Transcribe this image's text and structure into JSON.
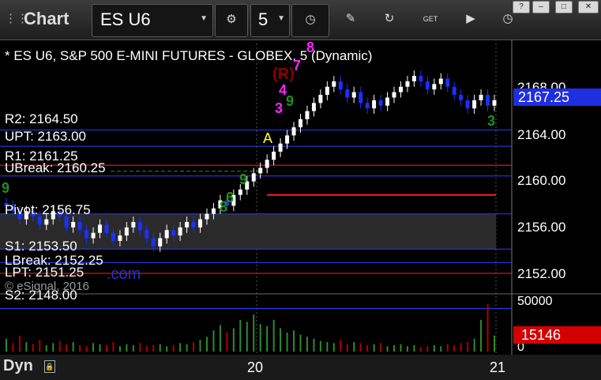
{
  "toolbar": {
    "title": "Chart",
    "symbol": "ES U6",
    "interval": "5"
  },
  "chart": {
    "header": "* ES U6, S&P 500 E-MINI FUTURES - GLOBEX, 5 (Dynamic)",
    "last_price": "2167.25",
    "volume_last": "15146",
    "volume_ticks": [
      "50000",
      "0"
    ],
    "price_ticks": [
      "2168.00",
      "2164.00",
      "2160.00",
      "2156.00",
      "2152.00"
    ],
    "date_ticks": [
      "20",
      "21"
    ],
    "status_label": "Dyn",
    "watermark": "© eSignal, 2016",
    "watermark_com": ".com",
    "signal_a": "A"
  },
  "levels": [
    {
      "label": "R2: 2164.50"
    },
    {
      "label": "UPT: 2163.00"
    },
    {
      "label": "R1: 2161.25"
    },
    {
      "label": "UBreak: 2160.25"
    },
    {
      "label": "Pivot: 2156.75"
    },
    {
      "label": "S1: 2153.50"
    },
    {
      "label": "LBreak: 2152.25"
    },
    {
      "label": "LPT: 2151.25"
    },
    {
      "label": "S2: 2148.00"
    }
  ],
  "sequence_labels": {
    "magenta": [
      "3",
      "4",
      "7",
      "8"
    ],
    "dark_red": "(R)",
    "green": [
      "9",
      "8",
      "6",
      "9",
      "9",
      "3"
    ]
  },
  "colors": {
    "up_candle": "#ffffff",
    "down_candle": "#1a30ff",
    "level_blue": "#2a3cff",
    "level_red": "#ff2020",
    "range_fill": "#2a2a2a",
    "volume_bar": "#b00000",
    "volume_bar_up": "#2e8b2e",
    "last_price_bg": "#1e2ee0",
    "volume_last_bg": "#d40000",
    "magenta": "#ff22ff",
    "green_count": "#1f8f1f"
  },
  "chart_data": {
    "type": "candlestick",
    "title": "* ES U6, S&P 500 E-MINI FUTURES - GLOBEX, 5 (Dynamic)",
    "y_unit": "price",
    "ylim": [
      2149.5,
      2172.5
    ],
    "horizontal_levels": [
      {
        "name": "R2",
        "value": 2164.5
      },
      {
        "name": "UPT",
        "value": 2163.0
      },
      {
        "name": "R1",
        "value": 2161.25
      },
      {
        "name": "UBreak",
        "value": 2160.25
      },
      {
        "name": "Pivot",
        "value": 2156.75
      },
      {
        "name": "S1",
        "value": 2153.5
      },
      {
        "name": "LBreak",
        "value": 2152.25
      },
      {
        "name": "LPT",
        "value": 2151.25
      },
      {
        "name": "S2",
        "value": 2148.0
      }
    ],
    "close_series": [
      2157.5,
      2157.0,
      2156.25,
      2157.0,
      2156.5,
      2155.75,
      2156.25,
      2157.0,
      2156.5,
      2155.5,
      2156.0,
      2155.25,
      2154.5,
      2155.0,
      2155.75,
      2155.0,
      2154.25,
      2154.75,
      2155.5,
      2156.0,
      2155.25,
      2154.5,
      2153.75,
      2154.5,
      2155.25,
      2154.75,
      2155.5,
      2156.0,
      2155.5,
      2156.25,
      2156.75,
      2157.25,
      2158.0,
      2157.5,
      2158.5,
      2159.0,
      2159.75,
      2160.5,
      2161.0,
      2161.75,
      2162.5,
      2163.25,
      2164.0,
      2164.75,
      2165.5,
      2166.25,
      2167.0,
      2167.75,
      2168.5,
      2169.0,
      2168.25,
      2167.5,
      2168.0,
      2167.0,
      2166.5,
      2167.25,
      2166.75,
      2167.5,
      2168.0,
      2168.5,
      2169.0,
      2169.5,
      2169.0,
      2168.25,
      2168.75,
      2169.25,
      2168.5,
      2167.75,
      2167.25,
      2166.5,
      2167.25,
      2167.75,
      2166.75,
      2167.25
    ],
    "volume_series": [
      12000,
      8000,
      15000,
      9000,
      7000,
      11000,
      6000,
      8000,
      10000,
      7000,
      9000,
      6000,
      5000,
      8000,
      7000,
      6000,
      9000,
      5000,
      7000,
      6000,
      8000,
      5000,
      6000,
      7000,
      5000,
      6000,
      8000,
      7000,
      9000,
      11000,
      14000,
      20000,
      25000,
      18000,
      22000,
      30000,
      28000,
      35000,
      26000,
      24000,
      30000,
      22000,
      18000,
      20000,
      16000,
      14000,
      12000,
      10000,
      9000,
      8000,
      11000,
      7000,
      9000,
      8000,
      6000,
      7000,
      8000,
      5000,
      6000,
      7000,
      5000,
      6000,
      4000,
      5000,
      6000,
      5000,
      7000,
      6000,
      8000,
      9000,
      12000,
      30000,
      45000,
      15146
    ],
    "volume_ylim": [
      0,
      50000
    ],
    "x_ticks": [
      "20",
      "21"
    ]
  }
}
